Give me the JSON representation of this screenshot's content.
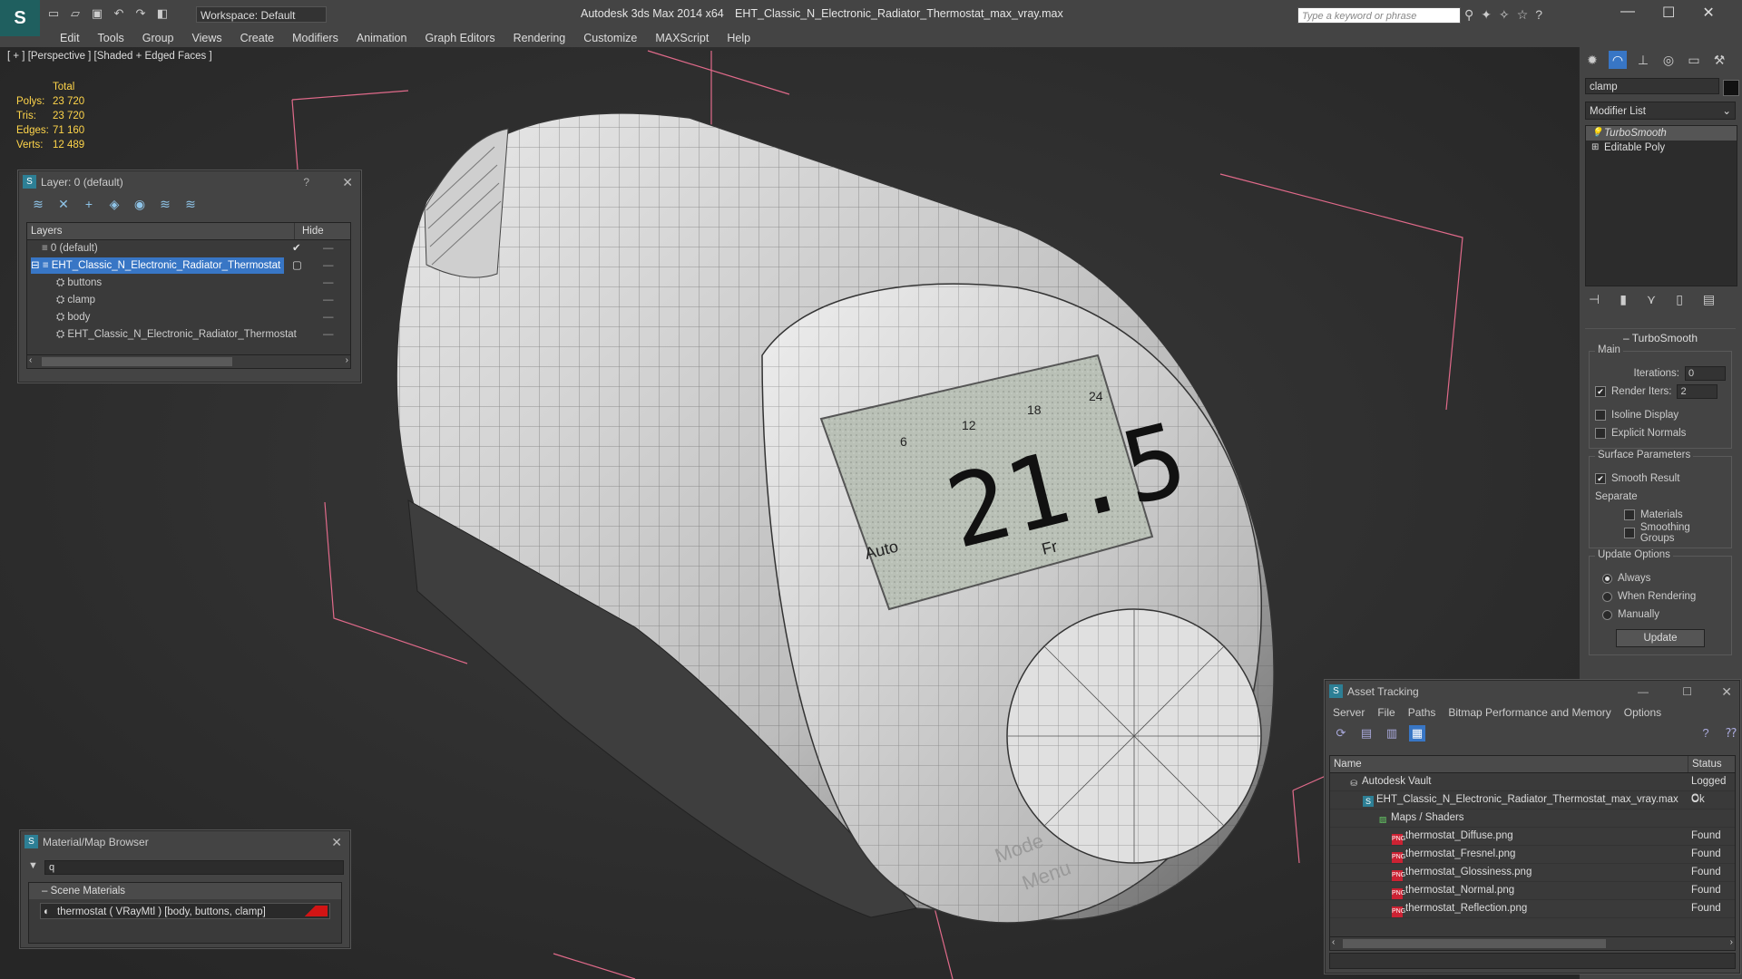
{
  "app": {
    "title": "Autodesk 3ds Max  2014 x64",
    "file_title": "EHT_Classic_N_Electronic_Radiator_Thermostat_max_vray.max",
    "workspace": "Workspace: Default",
    "search_placeholder": "Type a keyword or phrase"
  },
  "menu": [
    "Edit",
    "Tools",
    "Group",
    "Views",
    "Create",
    "Modifiers",
    "Animation",
    "Graph Editors",
    "Rendering",
    "Customize",
    "MAXScript",
    "Help"
  ],
  "viewport": {
    "label": "[ + ] [Perspective ] [Shaded + Edged Faces ]",
    "stats": {
      "total_label": "Total",
      "rows": [
        {
          "label": "Polys:",
          "value": "23 720"
        },
        {
          "label": "Tris:",
          "value": "23 720"
        },
        {
          "label": "Edges:",
          "value": "71 160"
        },
        {
          "label": "Verts:",
          "value": "12 489"
        }
      ]
    },
    "lcd": {
      "temp": "21.5",
      "mode": "Auto",
      "day": "Fr",
      "scale": [
        "6",
        "12",
        "18",
        "24"
      ]
    },
    "dial_text": {
      "mode": "Mode",
      "menu": "Menu"
    }
  },
  "layer_panel": {
    "title": "Layer: 0 (default)",
    "help": "?",
    "col_layers": "Layers",
    "col_hide": "Hide",
    "rows": [
      {
        "name": "0 (default)",
        "indent": 1,
        "checked": "✔"
      },
      {
        "name": "EHT_Classic_N_Electronic_Radiator_Thermostat",
        "indent": 1,
        "selected": true
      },
      {
        "name": "buttons",
        "indent": 2
      },
      {
        "name": "clamp",
        "indent": 2
      },
      {
        "name": "body",
        "indent": 2
      },
      {
        "name": "EHT_Classic_N_Electronic_Radiator_Thermostat",
        "indent": 2
      }
    ]
  },
  "material_browser": {
    "title": "Material/Map Browser",
    "search_value": "q",
    "group": "Scene Materials",
    "item": "thermostat  ( VRayMtl ) [body, buttons, clamp]"
  },
  "command_panel": {
    "object_name": "clamp",
    "modifier_list": "Modifier List",
    "stack": [
      {
        "name": "TurboSmooth",
        "active": true
      },
      {
        "name": "Editable Poly",
        "active": false
      }
    ],
    "rollout_title": "TurboSmooth",
    "main": {
      "title": "Main",
      "iterations_label": "Iterations:",
      "iterations": "0",
      "render_iters_label": "Render Iters:",
      "render_iters": "2",
      "isoline": "Isoline Display",
      "explicit": "Explicit Normals"
    },
    "surface": {
      "title": "Surface Parameters",
      "smooth": "Smooth Result",
      "separate": "Separate",
      "materials": "Materials",
      "smoothing": "Smoothing Groups"
    },
    "update": {
      "title": "Update Options",
      "always": "Always",
      "when_rendering": "When Rendering",
      "manually": "Manually",
      "button": "Update"
    }
  },
  "asset_tracking": {
    "title": "Asset Tracking",
    "menu": [
      "Server",
      "File",
      "Paths",
      "Bitmap Performance and Memory",
      "Options"
    ],
    "col_name": "Name",
    "col_status": "Status",
    "rows": [
      {
        "name": "Autodesk Vault",
        "indent": 1,
        "status": "Logged C",
        "icon": "vault"
      },
      {
        "name": "EHT_Classic_N_Electronic_Radiator_Thermostat_max_vray.max",
        "indent": 2,
        "status": "Ok",
        "icon": "max"
      },
      {
        "name": "Maps / Shaders",
        "indent": 3,
        "status": "",
        "icon": "maps"
      },
      {
        "name": "thermostat_Diffuse.png",
        "indent": 4,
        "status": "Found",
        "icon": "png"
      },
      {
        "name": "thermostat_Fresnel.png",
        "indent": 4,
        "status": "Found",
        "icon": "png"
      },
      {
        "name": "thermostat_Glossiness.png",
        "indent": 4,
        "status": "Found",
        "icon": "png"
      },
      {
        "name": "thermostat_Normal.png",
        "indent": 4,
        "status": "Found",
        "icon": "png"
      },
      {
        "name": "thermostat_Reflection.png",
        "indent": 4,
        "status": "Found",
        "icon": "png"
      }
    ]
  }
}
